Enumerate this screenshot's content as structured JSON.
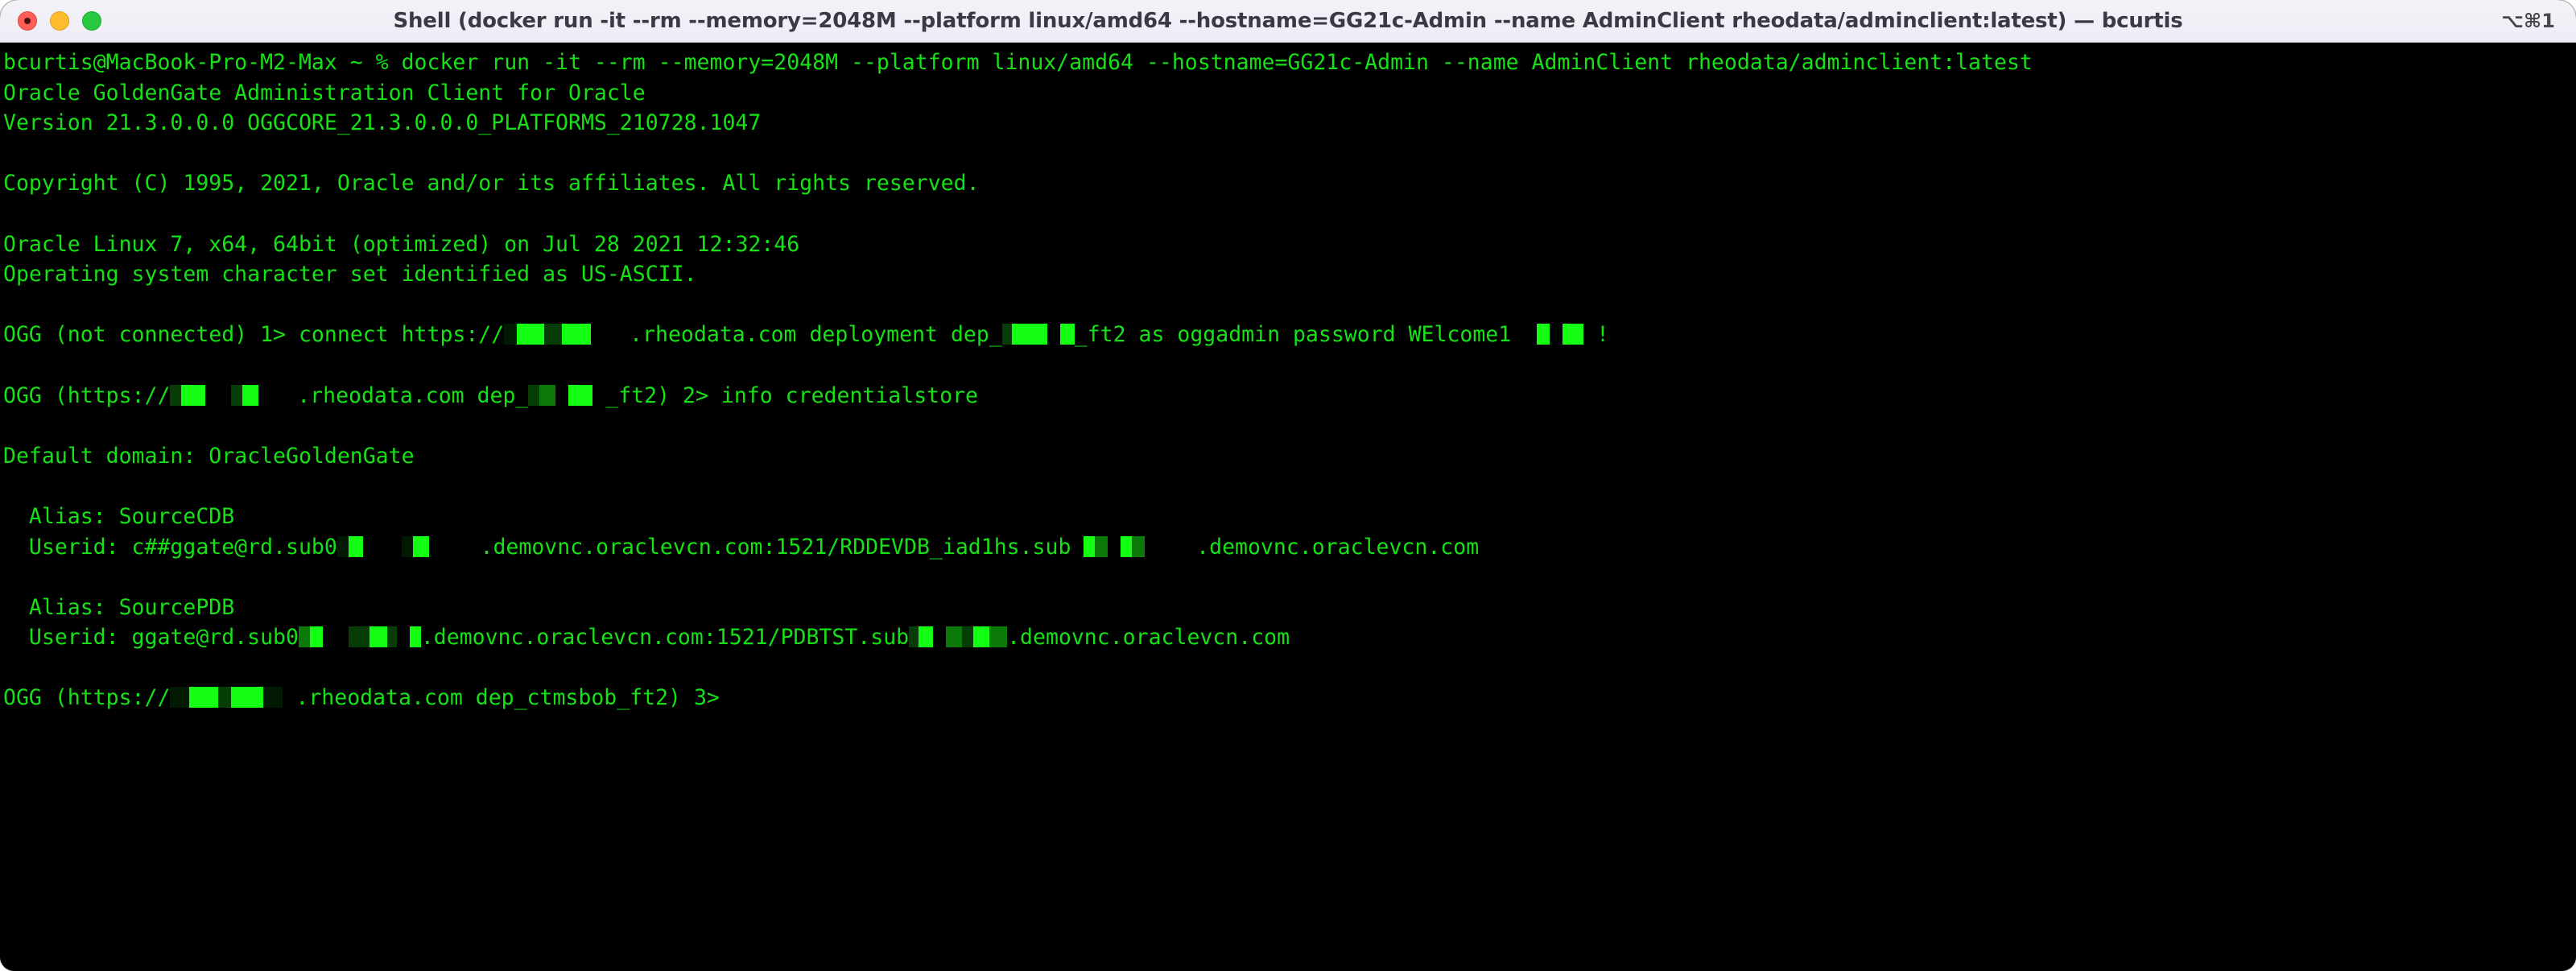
{
  "window": {
    "title": "Shell (docker run -it --rm --memory=2048M --platform linux/amd64 --hostname=GG21c-Admin --name AdminClient rheodata/adminclient:latest) — bcurtis",
    "shortcut_badge": "⌥⌘1",
    "traffic_lights": {
      "close_label": "Close",
      "minimize_label": "Minimize",
      "maximize_label": "Maximize"
    },
    "colors": {
      "titlebar_bg": "#f1f0f7",
      "titlebar_text": "#3a3a46",
      "terminal_bg": "#000000",
      "terminal_fg": "#17e017",
      "close": "#ff5f57",
      "minimize": "#febc2e",
      "maximize": "#28c840",
      "redaction_bright": "#15ff15",
      "redaction_mid": "#0b7a0b",
      "redaction_dark": "#063d06"
    }
  },
  "terminal": {
    "lines": [
      {
        "id": "shell-prompt-docker-run",
        "segments": [
          {
            "t": "bcurtis@MacBook-Pro-M2-Max ~ % docker run -it --rm --memory=2048M --platform linux/amd64 --hostname=GG21c-Admin --name AdminClient rheodata/adminclient:latest"
          }
        ]
      },
      {
        "id": "product-banner",
        "segments": [
          {
            "t": "Oracle GoldenGate Administration Client for Oracle"
          }
        ]
      },
      {
        "id": "version-line",
        "segments": [
          {
            "t": "Version 21.3.0.0.0 OGGCORE_21.3.0.0.0_PLATFORMS_210728.1047"
          }
        ]
      },
      {
        "id": "blank-1",
        "segments": [
          {
            "t": " "
          }
        ]
      },
      {
        "id": "copyright-line",
        "segments": [
          {
            "t": "Copyright (C) 1995, 2021, Oracle and/or its affiliates. All rights reserved."
          }
        ]
      },
      {
        "id": "blank-2",
        "segments": [
          {
            "t": " "
          }
        ]
      },
      {
        "id": "os-line",
        "segments": [
          {
            "t": "Oracle Linux 7, x64, 64bit (optimized) on Jul 28 2021 12:32:46"
          }
        ]
      },
      {
        "id": "charset-line",
        "segments": [
          {
            "t": "Operating system character set identified as US-ASCII."
          }
        ]
      },
      {
        "id": "blank-3",
        "segments": [
          {
            "t": " "
          }
        ]
      },
      {
        "id": "connect-command",
        "segments": [
          {
            "t": "OGG (not connected) 1> connect https://"
          },
          {
            "redact": true,
            "w": 16,
            "shade": "deep"
          },
          {
            "redact": true,
            "w": 34,
            "shade": "bright"
          },
          {
            "redact": true,
            "w": 22,
            "shade": "dark"
          },
          {
            "redact": true,
            "w": 36,
            "shade": "bright"
          },
          {
            "t": "   .rheodata.com deployment dep_"
          },
          {
            "redact": true,
            "w": 12,
            "shade": "dark"
          },
          {
            "redact": true,
            "w": 44,
            "shade": "bright"
          },
          {
            "t": " "
          },
          {
            "redact": true,
            "w": 18,
            "shade": "bright"
          },
          {
            "t": "_ft2 as oggadmin password WElcome1"
          },
          {
            "t": "  "
          },
          {
            "redact": true,
            "w": 16,
            "shade": "bright"
          },
          {
            "t": " "
          },
          {
            "redact": true,
            "w": 26,
            "shade": "bright"
          },
          {
            "t": " !"
          }
        ]
      },
      {
        "id": "blank-4",
        "segments": [
          {
            "t": " "
          }
        ]
      },
      {
        "id": "info-credentialstore-command",
        "segments": [
          {
            "t": "OGG (https://"
          },
          {
            "redact": true,
            "w": 14,
            "shade": "dark"
          },
          {
            "redact": true,
            "w": 30,
            "shade": "bright"
          },
          {
            "t": "  "
          },
          {
            "redact": true,
            "w": 14,
            "shade": "dark"
          },
          {
            "redact": true,
            "w": 20,
            "shade": "bright"
          },
          {
            "t": "   .rheodata.com dep_"
          },
          {
            "redact": true,
            "w": 14,
            "shade": "dark"
          },
          {
            "redact": true,
            "w": 20,
            "shade": "mid"
          },
          {
            "t": " "
          },
          {
            "redact": true,
            "w": 30,
            "shade": "bright"
          },
          {
            "t": " _ft2) 2> info credentialstore"
          }
        ]
      },
      {
        "id": "blank-5",
        "segments": [
          {
            "t": " "
          }
        ]
      },
      {
        "id": "default-domain-line",
        "segments": [
          {
            "t": "Default domain: OracleGoldenGate"
          }
        ]
      },
      {
        "id": "blank-6",
        "segments": [
          {
            "t": " "
          }
        ]
      },
      {
        "id": "alias-sourcecdb",
        "segments": [
          {
            "t": "  Alias: SourceCDB"
          }
        ]
      },
      {
        "id": "userid-sourcecdb",
        "segments": [
          {
            "t": "  Userid: c##ggate@rd.sub0"
          },
          {
            "redact": true,
            "w": 14,
            "shade": "deep"
          },
          {
            "redact": true,
            "w": 18,
            "shade": "bright"
          },
          {
            "t": "   "
          },
          {
            "redact": true,
            "w": 14,
            "shade": "deep"
          },
          {
            "redact": true,
            "w": 20,
            "shade": "bright"
          },
          {
            "t": "    .demovnc.oraclevcn.com:1521/RDDEVDB_iad1hs.sub "
          },
          {
            "redact": true,
            "w": 14,
            "shade": "bright"
          },
          {
            "redact": true,
            "w": 16,
            "shade": "mid"
          },
          {
            "t": " "
          },
          {
            "redact": true,
            "w": 14,
            "shade": "bright"
          },
          {
            "redact": true,
            "w": 16,
            "shade": "mid"
          },
          {
            "t": "    .demovnc.oraclevcn.com"
          }
        ]
      },
      {
        "id": "blank-7",
        "segments": [
          {
            "t": " "
          }
        ]
      },
      {
        "id": "alias-sourcepdb",
        "segments": [
          {
            "t": "  Alias: SourcePDB"
          }
        ]
      },
      {
        "id": "userid-sourcepdb",
        "segments": [
          {
            "t": "  Userid: ggate@rd.sub0"
          },
          {
            "redact": true,
            "w": 14,
            "shade": "mid"
          },
          {
            "redact": true,
            "w": 16,
            "shade": "bright"
          },
          {
            "t": "  "
          },
          {
            "redact": true,
            "w": 26,
            "shade": "dark"
          },
          {
            "redact": true,
            "w": 22,
            "shade": "bright"
          },
          {
            "redact": true,
            "w": 12,
            "shade": "dark"
          },
          {
            "t": " "
          },
          {
            "redact": true,
            "w": 14,
            "shade": "bright"
          },
          {
            "t": ".demovnc.oraclevcn.com:1521/PDBTST.sub"
          },
          {
            "redact": true,
            "w": 12,
            "shade": "dark"
          },
          {
            "redact": true,
            "w": 18,
            "shade": "bright"
          },
          {
            "t": " "
          },
          {
            "redact": true,
            "w": 20,
            "shade": "mid"
          },
          {
            "redact": true,
            "w": 14,
            "shade": "dark"
          },
          {
            "redact": true,
            "w": 20,
            "shade": "bright"
          },
          {
            "redact": true,
            "w": 22,
            "shade": "mid"
          },
          {
            "t": ".demovnc.oraclevcn.com"
          }
        ]
      },
      {
        "id": "blank-8",
        "segments": [
          {
            "t": " "
          }
        ]
      },
      {
        "id": "prompt-3",
        "segments": [
          {
            "t": "OGG (https://"
          },
          {
            "redact": true,
            "w": 24,
            "shade": "deep"
          },
          {
            "redact": true,
            "w": 36,
            "shade": "bright"
          },
          {
            "redact": true,
            "w": 16,
            "shade": "dark"
          },
          {
            "redact": true,
            "w": 40,
            "shade": "bright"
          },
          {
            "redact": true,
            "w": 24,
            "shade": "deep"
          },
          {
            "t": " .rheodata.com dep_ctmsbob_ft2) 3>"
          }
        ]
      }
    ]
  }
}
